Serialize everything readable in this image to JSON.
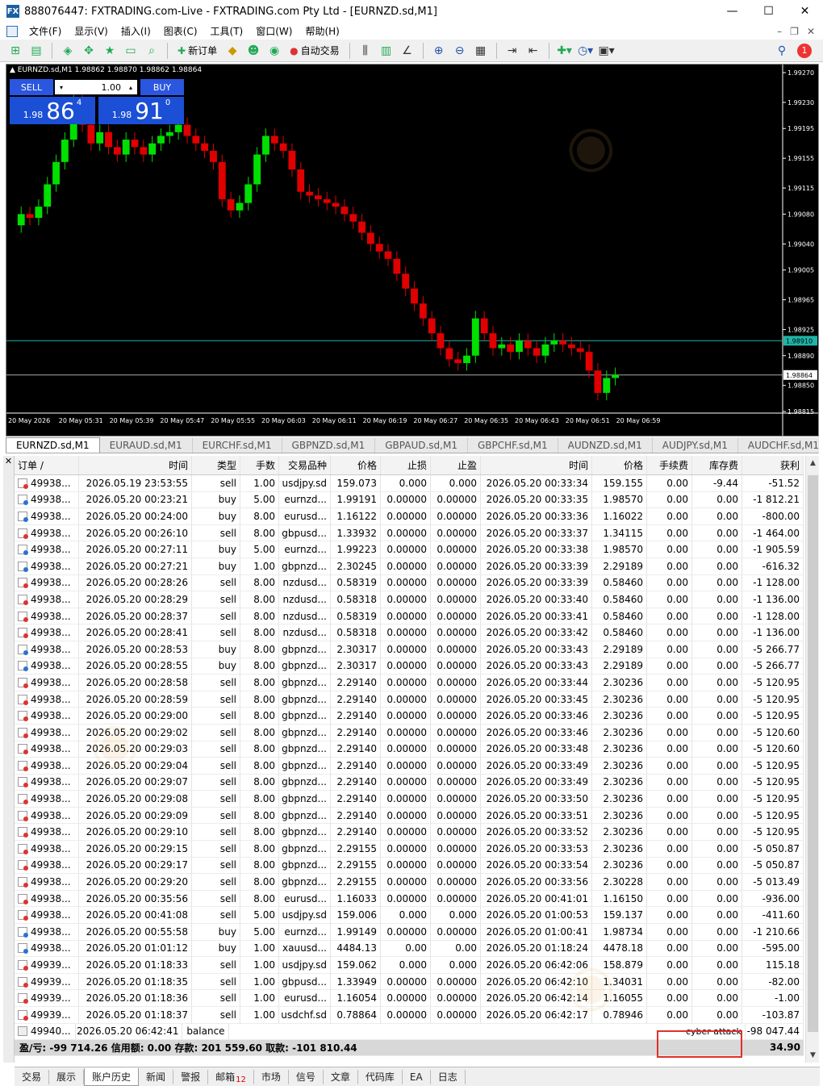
{
  "window": {
    "title": "888076447: FXTRADING.com-Live - FXTRADING.com Pty Ltd - [EURNZD.sd,M1]"
  },
  "menu": [
    "文件(F)",
    "显示(V)",
    "插入(I)",
    "图表(C)",
    "工具(T)",
    "窗口(W)",
    "帮助(H)"
  ],
  "toolbar": {
    "new_order": "新订单",
    "auto_trade": "自动交易",
    "alert_count": "1"
  },
  "chart": {
    "header": "▲ EURNZD.sd,M1  1.98862 1.98870 1.98862 1.98864",
    "sell_label": "SELL",
    "buy_label": "BUY",
    "lot": "1.00",
    "sell_small": "1.98",
    "sell_big": "86",
    "sell_sup": "4",
    "buy_small": "1.98",
    "buy_big": "91",
    "buy_sup": "0",
    "price_ticks": [
      "1.99270",
      "1.99230",
      "1.99195",
      "1.99155",
      "1.99115",
      "1.99080",
      "1.99040",
      "1.99005",
      "1.98965",
      "1.98925",
      "1.98890",
      "1.98850",
      "1.98815"
    ],
    "cyan_line": "1.98910",
    "bid_line": "1.98864",
    "time_ticks": [
      "20 May 2026",
      "20 May 05:31",
      "20 May 05:39",
      "20 May 05:47",
      "20 May 05:55",
      "20 May 06:03",
      "20 May 06:11",
      "20 May 06:19",
      "20 May 06:27",
      "20 May 06:35",
      "20 May 06:43",
      "20 May 06:51",
      "20 May 06:59"
    ]
  },
  "chart_tabs": [
    "EURNZD.sd,M1",
    "EURAUD.sd,M1",
    "EURCHF.sd,M1",
    "GBPNZD.sd,M1",
    "GBPAUD.sd,M1",
    "GBPCHF.sd,M1",
    "AUDNZD.sd,M1",
    "AUDJPY.sd,M1",
    "AUDCHF.sd,M1"
  ],
  "table": {
    "headers": [
      "订单 /",
      "时间",
      "类型",
      "手数",
      "交易品种",
      "价格",
      "止损",
      "止盈",
      "时间",
      "价格",
      "手续费",
      "库存费",
      "获利"
    ],
    "rows": [
      [
        "49938...",
        "2026.05.19 23:53:55",
        "sell",
        "1.00",
        "usdjpy.sd",
        "159.073",
        "0.000",
        "0.000",
        "2026.05.20 00:33:34",
        "159.155",
        "0.00",
        "-9.44",
        "-51.52"
      ],
      [
        "49938...",
        "2026.05.20 00:23:21",
        "buy",
        "5.00",
        "eurnzd...",
        "1.99191",
        "0.00000",
        "0.00000",
        "2026.05.20 00:33:35",
        "1.98570",
        "0.00",
        "0.00",
        "-1 812.21"
      ],
      [
        "49938...",
        "2026.05.20 00:24:00",
        "buy",
        "8.00",
        "eurusd...",
        "1.16122",
        "0.00000",
        "0.00000",
        "2026.05.20 00:33:36",
        "1.16022",
        "0.00",
        "0.00",
        "-800.00"
      ],
      [
        "49938...",
        "2026.05.20 00:26:10",
        "sell",
        "8.00",
        "gbpusd...",
        "1.33932",
        "0.00000",
        "0.00000",
        "2026.05.20 00:33:37",
        "1.34115",
        "0.00",
        "0.00",
        "-1 464.00"
      ],
      [
        "49938...",
        "2026.05.20 00:27:11",
        "buy",
        "5.00",
        "eurnzd...",
        "1.99223",
        "0.00000",
        "0.00000",
        "2026.05.20 00:33:38",
        "1.98570",
        "0.00",
        "0.00",
        "-1 905.59"
      ],
      [
        "49938...",
        "2026.05.20 00:27:21",
        "buy",
        "1.00",
        "gbpnzd...",
        "2.30245",
        "0.00000",
        "0.00000",
        "2026.05.20 00:33:39",
        "2.29189",
        "0.00",
        "0.00",
        "-616.32"
      ],
      [
        "49938...",
        "2026.05.20 00:28:26",
        "sell",
        "8.00",
        "nzdusd...",
        "0.58319",
        "0.00000",
        "0.00000",
        "2026.05.20 00:33:39",
        "0.58460",
        "0.00",
        "0.00",
        "-1 128.00"
      ],
      [
        "49938...",
        "2026.05.20 00:28:29",
        "sell",
        "8.00",
        "nzdusd...",
        "0.58318",
        "0.00000",
        "0.00000",
        "2026.05.20 00:33:40",
        "0.58460",
        "0.00",
        "0.00",
        "-1 136.00"
      ],
      [
        "49938...",
        "2026.05.20 00:28:37",
        "sell",
        "8.00",
        "nzdusd...",
        "0.58319",
        "0.00000",
        "0.00000",
        "2026.05.20 00:33:41",
        "0.58460",
        "0.00",
        "0.00",
        "-1 128.00"
      ],
      [
        "49938...",
        "2026.05.20 00:28:41",
        "sell",
        "8.00",
        "nzdusd...",
        "0.58318",
        "0.00000",
        "0.00000",
        "2026.05.20 00:33:42",
        "0.58460",
        "0.00",
        "0.00",
        "-1 136.00"
      ],
      [
        "49938...",
        "2026.05.20 00:28:53",
        "buy",
        "8.00",
        "gbpnzd...",
        "2.30317",
        "0.00000",
        "0.00000",
        "2026.05.20 00:33:43",
        "2.29189",
        "0.00",
        "0.00",
        "-5 266.77"
      ],
      [
        "49938...",
        "2026.05.20 00:28:55",
        "buy",
        "8.00",
        "gbpnzd...",
        "2.30317",
        "0.00000",
        "0.00000",
        "2026.05.20 00:33:43",
        "2.29189",
        "0.00",
        "0.00",
        "-5 266.77"
      ],
      [
        "49938...",
        "2026.05.20 00:28:58",
        "sell",
        "8.00",
        "gbpnzd...",
        "2.29140",
        "0.00000",
        "0.00000",
        "2026.05.20 00:33:44",
        "2.30236",
        "0.00",
        "0.00",
        "-5 120.95"
      ],
      [
        "49938...",
        "2026.05.20 00:28:59",
        "sell",
        "8.00",
        "gbpnzd...",
        "2.29140",
        "0.00000",
        "0.00000",
        "2026.05.20 00:33:45",
        "2.30236",
        "0.00",
        "0.00",
        "-5 120.95"
      ],
      [
        "49938...",
        "2026.05.20 00:29:00",
        "sell",
        "8.00",
        "gbpnzd...",
        "2.29140",
        "0.00000",
        "0.00000",
        "2026.05.20 00:33:46",
        "2.30236",
        "0.00",
        "0.00",
        "-5 120.95"
      ],
      [
        "49938...",
        "2026.05.20 00:29:02",
        "sell",
        "8.00",
        "gbpnzd...",
        "2.29140",
        "0.00000",
        "0.00000",
        "2026.05.20 00:33:46",
        "2.30236",
        "0.00",
        "0.00",
        "-5 120.60"
      ],
      [
        "49938...",
        "2026.05.20 00:29:03",
        "sell",
        "8.00",
        "gbpnzd...",
        "2.29140",
        "0.00000",
        "0.00000",
        "2026.05.20 00:33:48",
        "2.30236",
        "0.00",
        "0.00",
        "-5 120.60"
      ],
      [
        "49938...",
        "2026.05.20 00:29:04",
        "sell",
        "8.00",
        "gbpnzd...",
        "2.29140",
        "0.00000",
        "0.00000",
        "2026.05.20 00:33:49",
        "2.30236",
        "0.00",
        "0.00",
        "-5 120.95"
      ],
      [
        "49938...",
        "2026.05.20 00:29:07",
        "sell",
        "8.00",
        "gbpnzd...",
        "2.29140",
        "0.00000",
        "0.00000",
        "2026.05.20 00:33:49",
        "2.30236",
        "0.00",
        "0.00",
        "-5 120.95"
      ],
      [
        "49938...",
        "2026.05.20 00:29:08",
        "sell",
        "8.00",
        "gbpnzd...",
        "2.29140",
        "0.00000",
        "0.00000",
        "2026.05.20 00:33:50",
        "2.30236",
        "0.00",
        "0.00",
        "-5 120.95"
      ],
      [
        "49938...",
        "2026.05.20 00:29:09",
        "sell",
        "8.00",
        "gbpnzd...",
        "2.29140",
        "0.00000",
        "0.00000",
        "2026.05.20 00:33:51",
        "2.30236",
        "0.00",
        "0.00",
        "-5 120.95"
      ],
      [
        "49938...",
        "2026.05.20 00:29:10",
        "sell",
        "8.00",
        "gbpnzd...",
        "2.29140",
        "0.00000",
        "0.00000",
        "2026.05.20 00:33:52",
        "2.30236",
        "0.00",
        "0.00",
        "-5 120.95"
      ],
      [
        "49938...",
        "2026.05.20 00:29:15",
        "sell",
        "8.00",
        "gbpnzd...",
        "2.29155",
        "0.00000",
        "0.00000",
        "2026.05.20 00:33:53",
        "2.30236",
        "0.00",
        "0.00",
        "-5 050.87"
      ],
      [
        "49938...",
        "2026.05.20 00:29:17",
        "sell",
        "8.00",
        "gbpnzd...",
        "2.29155",
        "0.00000",
        "0.00000",
        "2026.05.20 00:33:54",
        "2.30236",
        "0.00",
        "0.00",
        "-5 050.87"
      ],
      [
        "49938...",
        "2026.05.20 00:29:20",
        "sell",
        "8.00",
        "gbpnzd...",
        "2.29155",
        "0.00000",
        "0.00000",
        "2026.05.20 00:33:56",
        "2.30228",
        "0.00",
        "0.00",
        "-5 013.49"
      ],
      [
        "49938...",
        "2026.05.20 00:35:56",
        "sell",
        "8.00",
        "eurusd...",
        "1.16033",
        "0.00000",
        "0.00000",
        "2026.05.20 00:41:01",
        "1.16150",
        "0.00",
        "0.00",
        "-936.00"
      ],
      [
        "49938...",
        "2026.05.20 00:41:08",
        "sell",
        "5.00",
        "usdjpy.sd",
        "159.006",
        "0.000",
        "0.000",
        "2026.05.20 01:00:53",
        "159.137",
        "0.00",
        "0.00",
        "-411.60"
      ],
      [
        "49938...",
        "2026.05.20 00:55:58",
        "buy",
        "5.00",
        "eurnzd...",
        "1.99149",
        "0.00000",
        "0.00000",
        "2026.05.20 01:00:41",
        "1.98734",
        "0.00",
        "0.00",
        "-1 210.66"
      ],
      [
        "49938...",
        "2026.05.20 01:01:12",
        "buy",
        "1.00",
        "xauusd...",
        "4484.13",
        "0.00",
        "0.00",
        "2026.05.20 01:18:24",
        "4478.18",
        "0.00",
        "0.00",
        "-595.00"
      ],
      [
        "49939...",
        "2026.05.20 01:18:33",
        "sell",
        "1.00",
        "usdjpy.sd",
        "159.062",
        "0.000",
        "0.000",
        "2026.05.20 06:42:06",
        "158.879",
        "0.00",
        "0.00",
        "115.18"
      ],
      [
        "49939...",
        "2026.05.20 01:18:35",
        "sell",
        "1.00",
        "gbpusd...",
        "1.33949",
        "0.00000",
        "0.00000",
        "2026.05.20 06:42:10",
        "1.34031",
        "0.00",
        "0.00",
        "-82.00"
      ],
      [
        "49939...",
        "2026.05.20 01:18:36",
        "sell",
        "1.00",
        "eurusd...",
        "1.16054",
        "0.00000",
        "0.00000",
        "2026.05.20 06:42:14",
        "1.16055",
        "0.00",
        "0.00",
        "-1.00"
      ],
      [
        "49939...",
        "2026.05.20 01:18:37",
        "sell",
        "1.00",
        "usdchf.sd",
        "0.78864",
        "0.00000",
        "0.00000",
        "2026.05.20 06:42:17",
        "0.78946",
        "0.00",
        "0.00",
        "-103.87"
      ]
    ],
    "balance_row": {
      "ticket": "49940...",
      "time": "2026.05.20 06:42:41",
      "type": "balance",
      "comment": "cyber attack",
      "profit": "-98 047.44"
    },
    "summary": {
      "text": "盈/亏: -99 714.26  信用额: 0.00  存款: 201 559.60  取款: -101 810.44",
      "total": "34.90"
    }
  },
  "bottom_tabs": [
    {
      "label": "交易"
    },
    {
      "label": "展示"
    },
    {
      "label": "账户历史",
      "active": true
    },
    {
      "label": "新闻"
    },
    {
      "label": "警报"
    },
    {
      "label": "邮箱",
      "badge": "12"
    },
    {
      "label": "市场"
    },
    {
      "label": "信号"
    },
    {
      "label": "文章"
    },
    {
      "label": "代码库"
    },
    {
      "label": "EA"
    },
    {
      "label": "日志"
    }
  ],
  "colors": {
    "bull": "#00e000",
    "bear": "#e00000",
    "cyan": "#1fb5a8",
    "accent": "#1b4fd6"
  }
}
